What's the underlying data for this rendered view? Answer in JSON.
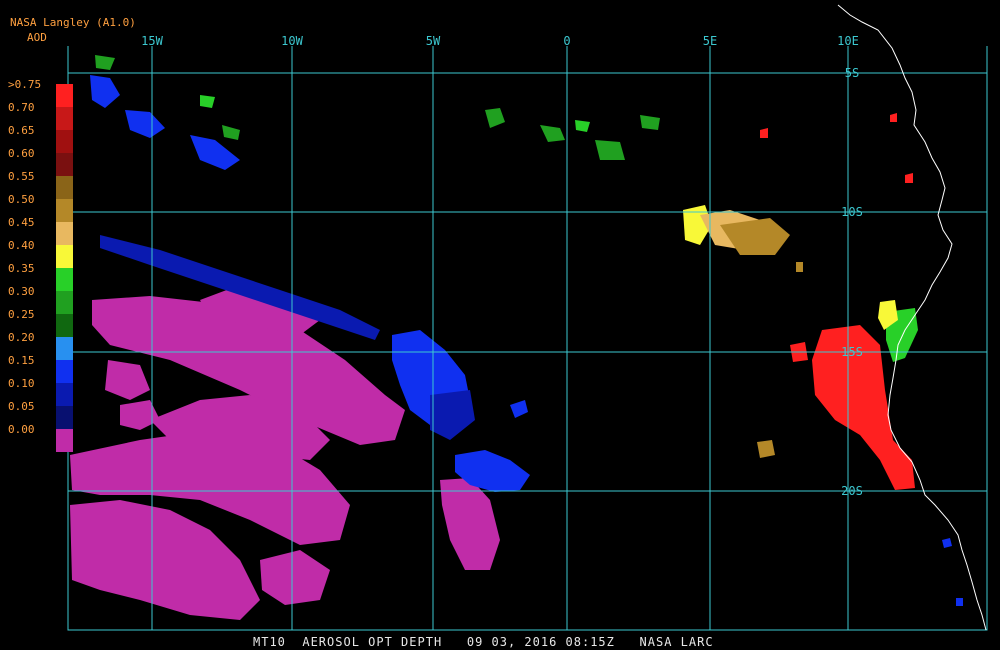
{
  "header": {
    "source": "NASA Langley (A1.0)",
    "product": "AOD"
  },
  "colorbar": {
    "labels": [
      ">0.75",
      "0.70",
      "0.65",
      "0.60",
      "0.55",
      "0.50",
      "0.45",
      "0.40",
      "0.35",
      "0.30",
      "0.25",
      "0.20",
      "0.15",
      "0.10",
      "0.05",
      "0.00"
    ],
    "colors": [
      "#ff2020",
      "#c81818",
      "#a01010",
      "#7a1010",
      "#8a6418",
      "#b48828",
      "#e8b860",
      "#f8f838",
      "#28d028",
      "#20a020",
      "#106810",
      "#2890f0",
      "#1030f0",
      "#0a1ab0",
      "#081070",
      "#c02ca8"
    ]
  },
  "map": {
    "grid_color": "#3cc8d0",
    "coast_color": "#ffffff",
    "lon_labels": [
      "15W",
      "10W",
      "5W",
      "0",
      "5E",
      "10E"
    ],
    "lat_labels": [
      "5S",
      "10S",
      "15S",
      "20S"
    ]
  },
  "caption": "MT10  AEROSOL OPT DEPTH   09 03, 2016 08:15Z   NASA LARC"
}
